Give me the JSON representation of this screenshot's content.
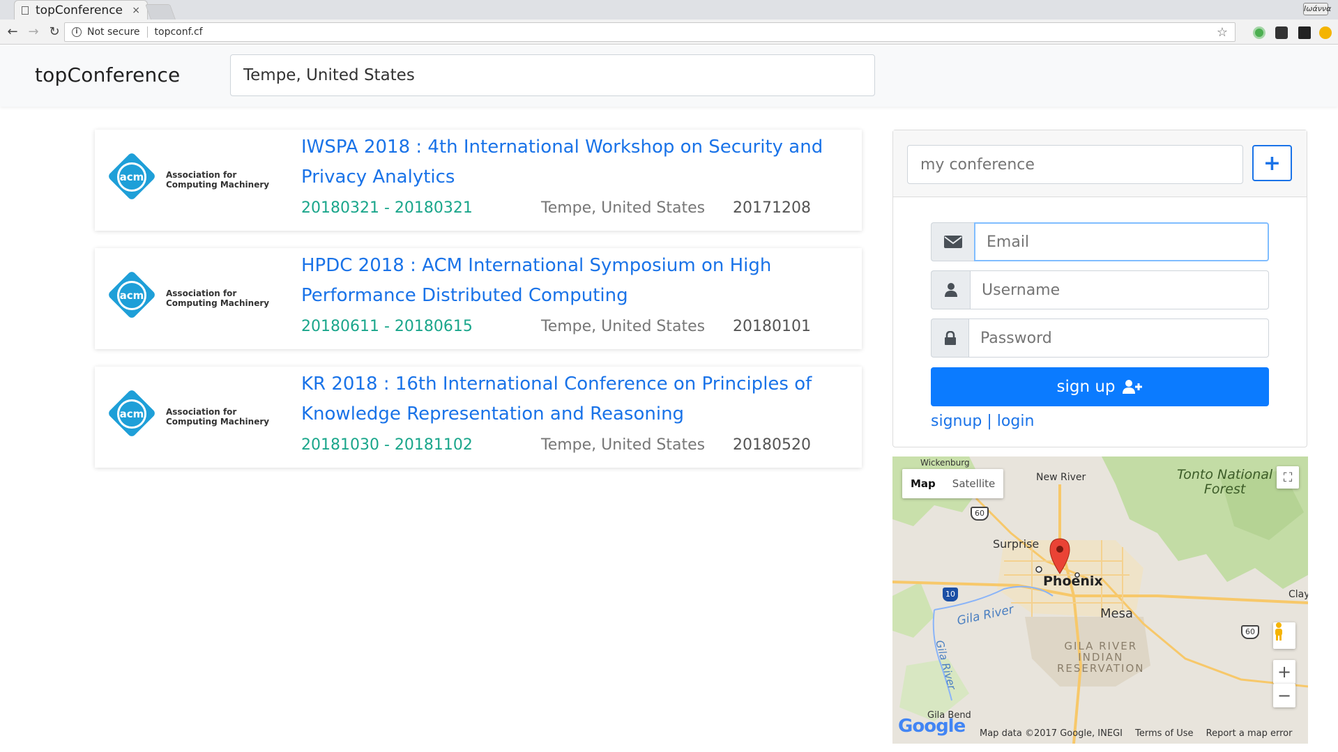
{
  "browser": {
    "tab_title": "topConference",
    "tab_close": "×",
    "security_label": "Not secure",
    "url": "topconf.cf",
    "profile_badge": "Ιωάννα"
  },
  "navbar": {
    "brand": "topConference",
    "search_value": "Tempe, United States"
  },
  "conferences": [
    {
      "title": "IWSPA 2018 : 4th International Workshop on Security and Privacy Analytics",
      "dates": "20180321 - 20180321",
      "location": "Tempe, United States",
      "deadline": "20171208",
      "logo_text": "Association for\nComputing Machinery",
      "logo_mark": "acm"
    },
    {
      "title": "HPDC 2018 : ACM International Symposium on High Performance Distributed Computing",
      "dates": "20180611 - 20180615",
      "location": "Tempe, United States",
      "deadline": "20180101",
      "logo_text": "Association for\nComputing Machinery",
      "logo_mark": "acm"
    },
    {
      "title": "KR 2018 : 16th International Conference on Principles of Knowledge Representation and Reasoning",
      "dates": "20181030 - 20181102",
      "location": "Tempe, United States",
      "deadline": "20180520",
      "logo_text": "Association for\nComputing Machinery",
      "logo_mark": "acm"
    }
  ],
  "panel": {
    "myconf_placeholder": "my conference",
    "add_button": "+",
    "email_placeholder": "Email",
    "username_placeholder": "Username",
    "password_placeholder": "Password",
    "signup_label": "sign up",
    "links": "signup | login"
  },
  "map": {
    "type_map": "Map",
    "type_satellite": "Satellite",
    "labels": {
      "wickenburg": "Wickenburg",
      "new_river": "New River",
      "tonto": "Tonto National\nForest",
      "surprise": "Surprise",
      "phoenix": "Phoenix",
      "mesa": "Mesa",
      "clay": "Clay",
      "gila_river": "Gila River",
      "gila_river2": "Gila River",
      "reservation": "GILA RIVER\nINDIAN\nRESERVATION",
      "gila_bend": "Gila Bend",
      "shield_60a": "60",
      "shield_10": "10",
      "shield_60b": "60"
    },
    "zoom_in": "+",
    "zoom_out": "−",
    "google": "Google",
    "footer": {
      "data": "Map data ©2017 Google, INEGI",
      "terms": "Terms of Use",
      "report": "Report a map error"
    }
  },
  "colors": {
    "link": "#1a73e8",
    "dates": "#1aa68b",
    "primary": "#0b7bff",
    "acm": "#1e9fd8"
  }
}
